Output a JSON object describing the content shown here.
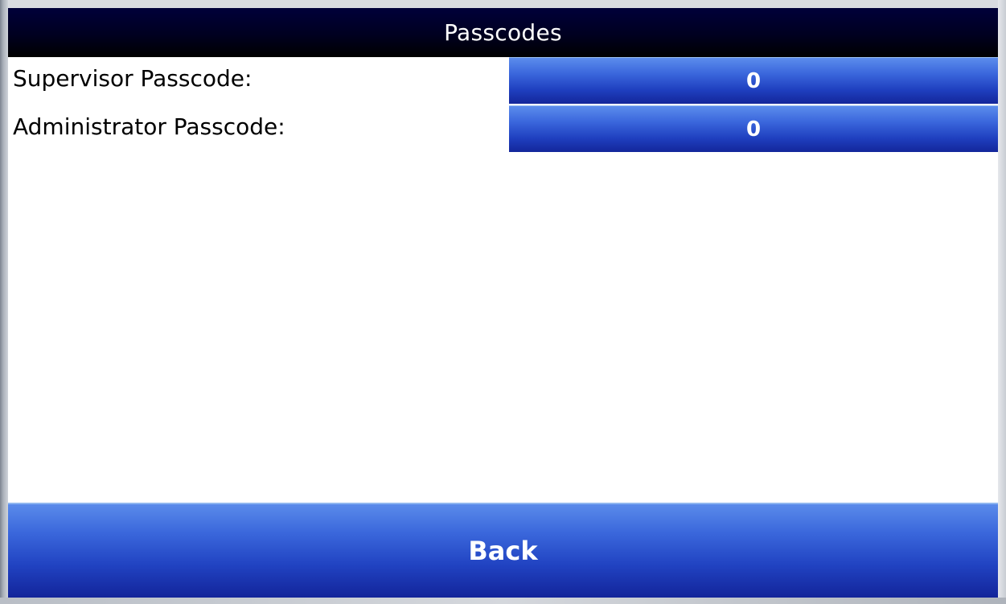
{
  "screen": {
    "title": "Passcodes"
  },
  "settings": [
    {
      "label": "Supervisor Passcode:",
      "value": "0"
    },
    {
      "label": "Administrator Passcode:",
      "value": "0"
    }
  ],
  "footer": {
    "back_label": "Back"
  },
  "colors": {
    "title_bar": "#000020",
    "button_blue": "#2a4fd0",
    "button_highlight": "#5b8cec",
    "text_dark": "#000000",
    "text_light": "#ffffff"
  }
}
